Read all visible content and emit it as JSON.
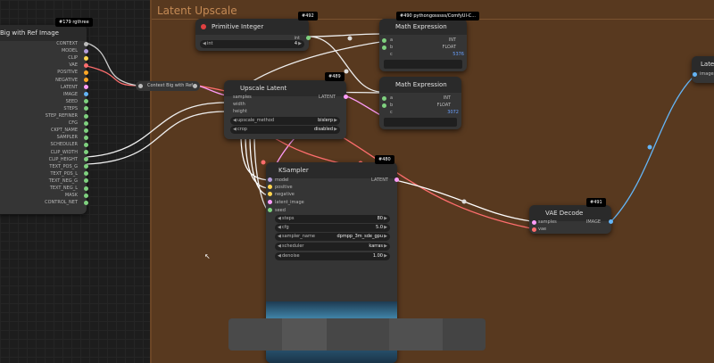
{
  "group": {
    "title": "Latent Upscale"
  },
  "ctx_node": {
    "badge": "#179 rgthree",
    "title": "Big with Ref Image",
    "outputs": [
      "CONTEXT",
      "MODEL",
      "CLIP",
      "VAE",
      "POSITIVE",
      "NEGATIVE",
      "LATENT",
      "IMAGE",
      "SEED",
      "STEPS",
      "STEP_REFINER",
      "CFG",
      "CKPT_NAME",
      "SAMPLER",
      "SCHEDULER",
      "CLIP_WIDTH",
      "CLIP_HEIGHT",
      "TEXT_POS_G",
      "TEXT_POS_L",
      "TEXT_NEG_G",
      "TEXT_NEG_L",
      "MASK",
      "CONTROL_NET"
    ]
  },
  "reroute": {
    "label": "Context Big with Ref"
  },
  "primitive": {
    "badge": "#492",
    "title": "Primitive Integer",
    "output": "int",
    "widget_label": "int",
    "widget_value": "4"
  },
  "math1": {
    "badge": "#490 pythongosssss/ComfyUI-C...",
    "title": "Math Expression",
    "inputs": [
      "a",
      "b",
      "c"
    ],
    "outputs": [
      "INT",
      "FLOAT"
    ],
    "value": "5376"
  },
  "math2": {
    "title": "Math Expression",
    "inputs": [
      "a",
      "b",
      "c"
    ],
    "outputs": [
      "INT",
      "FLOAT"
    ],
    "value": "3072"
  },
  "upscale": {
    "badge": "#489",
    "title": "Upscale Latent",
    "inputs": [
      "samples",
      "width",
      "height"
    ],
    "output": "LATENT",
    "widgets": [
      {
        "label": "upscale_method",
        "value": "bislerp"
      },
      {
        "label": "crop",
        "value": "disabled"
      }
    ]
  },
  "ksampler": {
    "badge": "#480",
    "title": "KSampler",
    "inputs": [
      "model",
      "positive",
      "negative",
      "latent_image",
      "seed"
    ],
    "output": "LATENT",
    "widgets": [
      {
        "label": "steps",
        "value": "80"
      },
      {
        "label": "cfg",
        "value": "5.0"
      },
      {
        "label": "sampler_name",
        "value": "dpmpp_3m_sde_gpu"
      },
      {
        "label": "scheduler",
        "value": "karras"
      },
      {
        "label": "denoise",
        "value": "1.00"
      }
    ]
  },
  "vae_decode": {
    "badge": "#491",
    "title": "VAE Decode",
    "inputs": [
      "samples",
      "vae"
    ],
    "output": "IMAGE"
  },
  "latent_partial": {
    "title": "Latent",
    "input": "images"
  },
  "colors": {
    "group_bg": "#58391f",
    "link_latent": "#ff9cf9",
    "link_image": "#64b5f6",
    "link_vae": "#ff6e6e",
    "link_int": "#dddddd"
  }
}
